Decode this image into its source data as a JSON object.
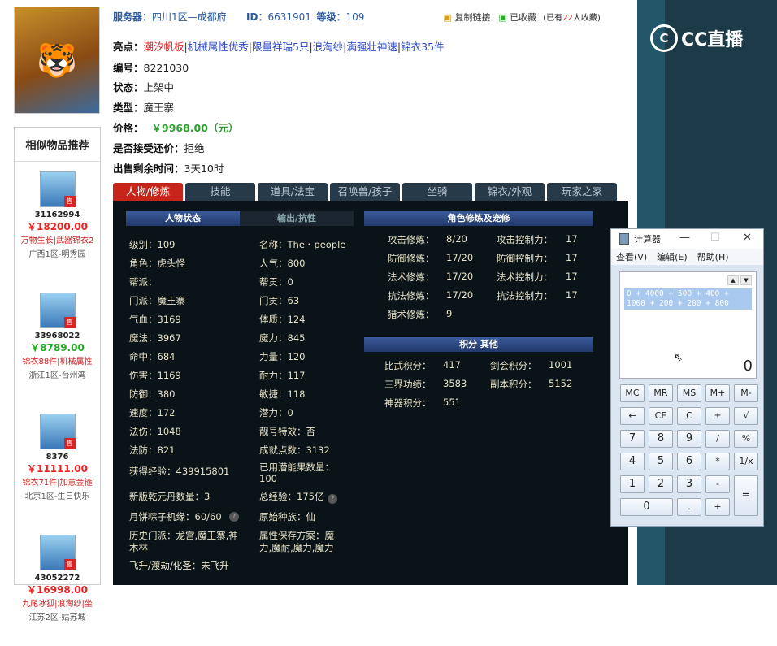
{
  "topbar": {
    "server_label": "服务器：",
    "server_value": "四川1区—成都府",
    "id_label": "ID：",
    "id_value": "6631901",
    "level_label": "等级：",
    "level_value": "109",
    "copy_link": "复制链接",
    "favorited": "已收藏",
    "fav_count_pre": "(已有",
    "fav_count": "22",
    "fav_count_post": "人收藏)"
  },
  "info": {
    "highlights_label": "亮点：",
    "highlights": [
      "潮汐帆板",
      "机械属性优秀",
      "限量祥瑞5只",
      "浪淘纱",
      "满强壮神速",
      "锦衣35件"
    ],
    "sep": "|",
    "number_label": "编号：",
    "number": "8221030",
    "status_label": "状态：",
    "status": "上架中",
    "type_label": "类型：",
    "type": "魔王寨",
    "price_label": "价格：",
    "price": "￥9968.00（元）",
    "counter_label": "是否接受还价：",
    "counter": "拒绝",
    "remaining_label": "出售剩余时间：",
    "remaining": "3天10时"
  },
  "tabs": [
    "人物/修炼",
    "技能",
    "道具/法宝",
    "召唤兽/孩子",
    "坐骑",
    "锦衣/外观",
    "玩家之家"
  ],
  "sidebar": {
    "title": "相似物品推荐",
    "items": [
      {
        "id": "31162994",
        "price": "￥18200.00",
        "tags": "万物生长|武器锦衣2",
        "server": "广西1区-明秀园"
      },
      {
        "id": "33968022",
        "price": "￥8789.00",
        "tags": "锦衣88件|机械属性",
        "server": "浙江1区-台州湾"
      },
      {
        "id": "8376",
        "price": "￥11111.00",
        "tags": "锦衣71件|加意金箍",
        "server": "北京1区-生日快乐"
      },
      {
        "id": "43052272",
        "price": "￥16998.00",
        "tags": "九尾冰狐|浪淘纱|坐",
        "server": "江苏2区-姑苏城"
      }
    ],
    "sell_tag": "售"
  },
  "panel": {
    "status_header": "人物状态",
    "resist_header": "输出/抗性",
    "cultivate_header": "角色修炼及宠修",
    "score_header": "积分 其他",
    "left_col": [
      "级别：109",
      "角色：虎头怪",
      "帮派：",
      "门派：魔王寨",
      "气血：3169",
      "魔法：3967",
      "命中：684",
      "伤害：1169",
      "防御：380",
      "速度：172",
      "法伤：1048",
      "法防：821",
      "获得经验：439915801",
      "新版乾元丹数量：3",
      "月饼粽子机缘：60/60",
      "历史门派：龙宫,魔王寨,神",
      "木林",
      "飞升/渡劫/化圣：未飞升"
    ],
    "mid_col": [
      "名称：The・people",
      "人气：800",
      "帮贡：0",
      "门贡：63",
      "体质：124",
      "魔力：845",
      "力量：120",
      "耐力：117",
      "敏捷：118",
      "潜力：0",
      "靓号特效：否",
      "成就点数：3132",
      "已用潜能果数量：",
      "100",
      "总经验：175亿",
      "原始种族：仙",
      "属性保存方案：魔",
      "力,魔耐,魔力,魔力"
    ],
    "cult_left": [
      "攻击修炼：",
      "防御修炼：",
      "法术修炼：",
      "抗法修炼：",
      "猎术修炼："
    ],
    "cult_left_val": [
      "8/20",
      "17/20",
      "17/20",
      "17/20",
      "9"
    ],
    "cult_right": [
      "攻击控制力：",
      "防御控制力：",
      "法术控制力：",
      "抗法控制力："
    ],
    "cult_right_val": [
      "17",
      "17",
      "17",
      "17"
    ],
    "scores": [
      "比武积分：",
      "三界功绩：",
      "神器积分："
    ],
    "score_vals": [
      "417",
      "3583",
      "551"
    ],
    "scores2": [
      "剑会积分：",
      "副本积分："
    ],
    "score_vals2": [
      "1001",
      "5152"
    ]
  },
  "calculator": {
    "title": "计算器",
    "menu": [
      "查看(V)",
      "编辑(E)",
      "帮助(H)"
    ],
    "history": [
      "0 + 4000 + 500 + 400 +",
      "1000 + 200 + 200 + 800"
    ],
    "value": "0",
    "keys": [
      "MC",
      "MR",
      "MS",
      "M+",
      "M-",
      "←",
      "CE",
      "C",
      "±",
      "√",
      "7",
      "8",
      "9",
      "/",
      "%",
      "4",
      "5",
      "6",
      "*",
      "1/x",
      "1",
      "2",
      "3",
      "-",
      "=",
      "0",
      ".",
      "+"
    ]
  },
  "brand": {
    "name": "CC直播"
  }
}
